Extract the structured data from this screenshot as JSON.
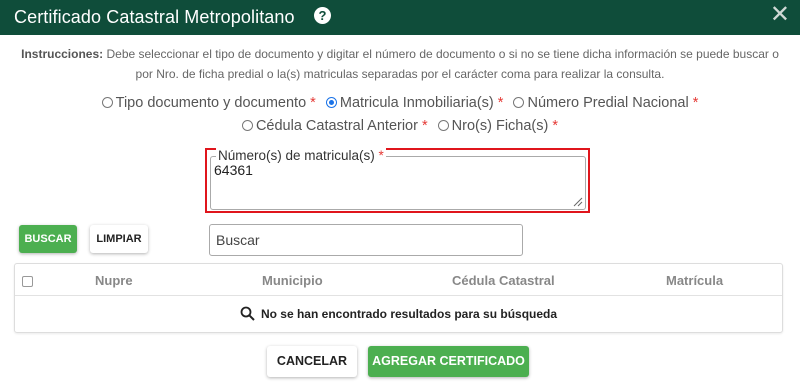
{
  "header": {
    "title": "Certificado Catastral Metropolitano",
    "help_glyph": "?",
    "close_glyph": "✕",
    "background_color": "#0f4d3a"
  },
  "instructions": {
    "label": "Instrucciones:",
    "text": " Debe seleccionar el tipo de documento y digitar el número de documento o si no se tiene dicha información se puede buscar o por Nro. de ficha predial o la(s) matriculas separadas por el carácter coma para realizar la consulta."
  },
  "search_options": [
    {
      "label": "Tipo documento y documento",
      "required_mark": "*",
      "selected": false
    },
    {
      "label": "Matricula Inmobiliaria(s)",
      "required_mark": "*",
      "selected": true
    },
    {
      "label": "Número Predial Nacional",
      "required_mark": "*",
      "selected": false
    },
    {
      "label": "Cédula Catastral Anterior",
      "required_mark": "*",
      "selected": false
    },
    {
      "label": "Nro(s) Ficha(s)",
      "required_mark": "*",
      "selected": false
    }
  ],
  "matricula_field": {
    "label": "Número(s) de matricula(s)",
    "required_mark": "*",
    "value": "64361"
  },
  "actions": {
    "search_label": "BUSCAR",
    "clear_label": "LIMPIAR",
    "filter_placeholder": "Buscar",
    "cancel_label": "CANCELAR",
    "add_label": "AGREGAR CERTIFICADO"
  },
  "table": {
    "columns": [
      "Nupre",
      "Municipio",
      "Cédula Catastral",
      "Matrícula"
    ],
    "empty_message": "No se han encontrado resultados para su búsqueda",
    "rows": []
  },
  "colors": {
    "accent_green": "#4caf50",
    "required_red": "#e53935",
    "highlight_red": "#e0151c",
    "radio_blue": "#1a73e8"
  }
}
